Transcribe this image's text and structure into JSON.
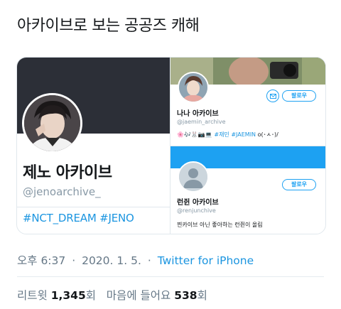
{
  "tweet": {
    "text": "아카이브로 보는 공공즈 캐해",
    "time": "오후 6:37",
    "date": "2020. 1. 5.",
    "separator": "·",
    "source": "Twitter for iPhone"
  },
  "stats": {
    "retweets_label": "리트윗",
    "retweets_count": "1,345",
    "retweets_unit": "회",
    "likes_label": "마음에 들어요",
    "likes_count": "538",
    "likes_unit": "회"
  },
  "profiles": {
    "jeno": {
      "name": "제노 아카이브",
      "handle": "@jenoarchive_",
      "tags": "#NCT_DREAM #JENO"
    },
    "jaemin": {
      "name": "나나 아카이브",
      "handle": "@jaemin_archive",
      "follow_label": "팔로우",
      "bio_emoji": "🌸🎶🐰📷💻",
      "bio_tag1": "#재민",
      "bio_tag2": "#JAEMIN",
      "bio_tail": "o(･ㅅ･)/"
    },
    "renjun": {
      "name": "런쥔 아카이브",
      "handle": "@renjunchive",
      "follow_label": "팔로우",
      "bio": "찐카이브 아닌 좋아하는 런쥔이 올림"
    }
  },
  "colors": {
    "accent": "#1da1f2",
    "link": "#1b95e0",
    "muted": "#657786",
    "left_banner": "#2c2f37",
    "renjun_banner": "#1da1f2"
  }
}
